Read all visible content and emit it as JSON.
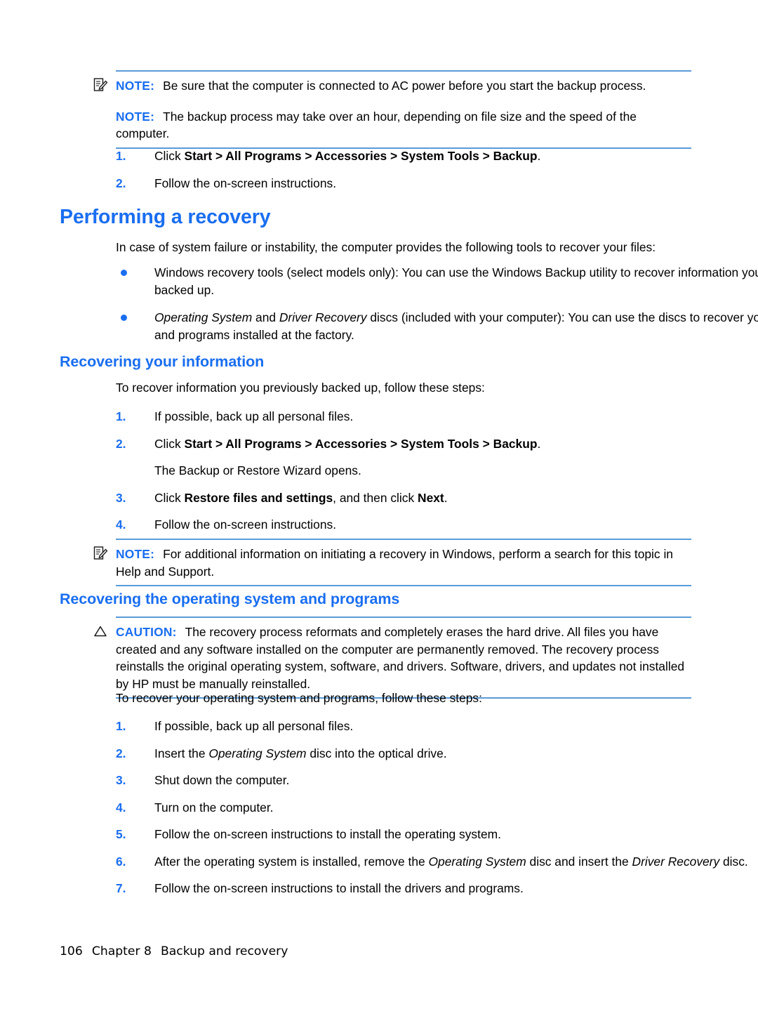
{
  "note_top": {
    "icon": "note-pencil-icon",
    "label": "NOTE:",
    "paragraph1": "Be sure that the computer is connected to AC power before you start the backup process.",
    "label2": "NOTE:",
    "paragraph2_a": "The backup process may take over an hour, depending on file size and the speed of the",
    "paragraph2_b": "computer."
  },
  "steps_top": [
    {
      "num": "1.",
      "pre": "Click ",
      "bold": "Start > All Programs > Accessories > System Tools > Backup",
      "post": "."
    },
    {
      "num": "2.",
      "pre": "Follow the on-screen instructions.",
      "bold": "",
      "post": ""
    }
  ],
  "heading_main": "Performing a recovery",
  "intro": "In case of system failure or instability, the computer provides the following tools to recover your files:",
  "bullets": [
    {
      "seg1": "Windows recovery tools (select models only): You can use the Windows Backup utility to recover information you have previously backed up.",
      "italic1": "",
      "seg2": "",
      "italic2": "",
      "seg3": ""
    },
    {
      "seg1": "",
      "italic1": "Operating System",
      "seg2": " and ",
      "italic2": "Driver Recovery",
      "seg3": " discs (included with your computer): You can use the discs to recover your operating system and programs installed at the factory."
    }
  ],
  "heading_sub1": "Recovering your information",
  "recover_intro": "To recover information you previously backed up, follow these steps:",
  "steps_recover": [
    {
      "num": "1.",
      "pre": "If possible, back up all personal files.",
      "bold": "",
      "post": ""
    },
    {
      "num": "2.",
      "pre": "Click ",
      "bold": "Start > All Programs > Accessories > System Tools > Backup",
      "post": ".",
      "sub": "The Backup or Restore Wizard opens."
    },
    {
      "num": "3.",
      "pre": "Click ",
      "bold": "Restore files and settings",
      "post": ", and then click ",
      "bold2": "Next",
      "post2": "."
    },
    {
      "num": "4.",
      "pre": "Follow the on-screen instructions.",
      "bold": "",
      "post": ""
    }
  ],
  "note_mid": {
    "icon": "note-pencil-icon",
    "label": "NOTE:",
    "text": "For additional information on initiating a recovery in Windows, perform a search for this topic in Help and Support."
  },
  "heading_sub2": "Recovering the operating system and programs",
  "caution": {
    "icon": "warning-triangle-icon",
    "label": "CAUTION:",
    "text": "The recovery process reformats and completely erases the hard drive. All files you have created and any software installed on the computer are permanently removed. The recovery process reinstalls the original operating system, software, and drivers. Software, drivers, and updates not installed by HP must be manually reinstalled."
  },
  "os_intro": "To recover your operating system and programs, follow these steps:",
  "steps_os": [
    {
      "num": "1.",
      "seg1": "If possible, back up all personal files.",
      "italic1": "",
      "seg2": "",
      "italic2": "",
      "seg3": ""
    },
    {
      "num": "2.",
      "seg1": "Insert the ",
      "italic1": "Operating System",
      "seg2": " disc into the optical drive.",
      "italic2": "",
      "seg3": ""
    },
    {
      "num": "3.",
      "seg1": "Shut down the computer.",
      "italic1": "",
      "seg2": "",
      "italic2": "",
      "seg3": ""
    },
    {
      "num": "4.",
      "seg1": "Turn on the computer.",
      "italic1": "",
      "seg2": "",
      "italic2": "",
      "seg3": ""
    },
    {
      "num": "5.",
      "seg1": "Follow the on-screen instructions to install the operating system.",
      "italic1": "",
      "seg2": "",
      "italic2": "",
      "seg3": ""
    },
    {
      "num": "6.",
      "seg1": "After the operating system is installed, remove the ",
      "italic1": "Operating System",
      "seg2": " disc and insert the ",
      "italic2": "Driver Recovery",
      "seg3": " disc."
    },
    {
      "num": "7.",
      "seg1": "Follow the on-screen instructions to install the drivers and programs.",
      "italic1": "",
      "seg2": "",
      "italic2": "",
      "seg3": ""
    }
  ],
  "footer": {
    "page_number": "106",
    "chapter": "Chapter 8",
    "chapter_title": "Backup and recovery"
  },
  "colors": {
    "accent_blue": "#1a6ef0",
    "rule_blue": "#5a9bd8",
    "text_black": "#000000"
  }
}
